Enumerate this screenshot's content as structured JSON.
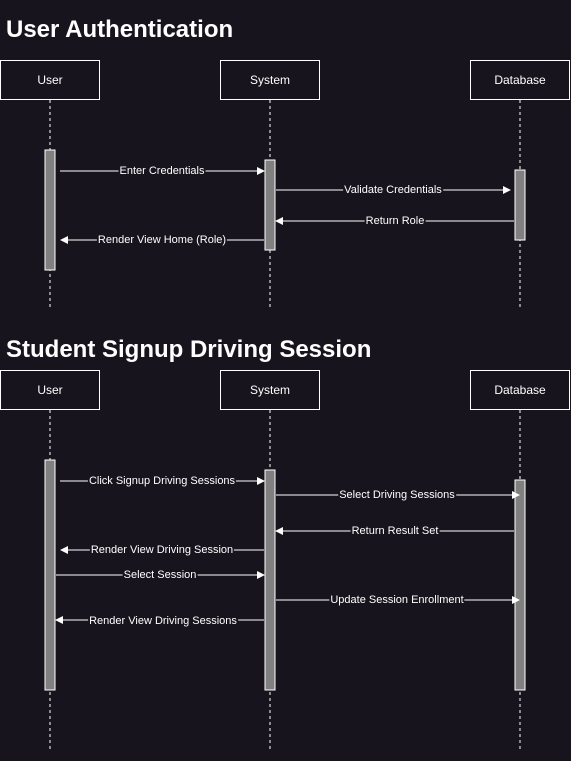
{
  "diagrams": [
    {
      "title": "User Authentication",
      "actors": [
        "User",
        "System",
        "Database"
      ],
      "messages": [
        {
          "label": "Enter Credentials",
          "from": "User",
          "to": "System"
        },
        {
          "label": "Validate Credentials",
          "from": "System",
          "to": "Database"
        },
        {
          "label": "Return Role",
          "from": "Database",
          "to": "System"
        },
        {
          "label": "Render View Home (Role)",
          "from": "System",
          "to": "User"
        }
      ]
    },
    {
      "title": "Student Signup Driving Session",
      "actors": [
        "User",
        "System",
        "Database"
      ],
      "messages": [
        {
          "label": "Click Signup Driving Sessions",
          "from": "User",
          "to": "System"
        },
        {
          "label": "Select Driving Sessions",
          "from": "System",
          "to": "Database"
        },
        {
          "label": "Return Result Set",
          "from": "Database",
          "to": "System"
        },
        {
          "label": "Render View Driving Session",
          "from": "System",
          "to": "User"
        },
        {
          "label": "Select Session",
          "from": "User",
          "to": "System"
        },
        {
          "label": "Update Session Enrollment",
          "from": "System",
          "to": "Database"
        },
        {
          "label": "Render View Driving Sessions",
          "from": "System",
          "to": "User"
        }
      ]
    }
  ],
  "colors": {
    "background": "#18141d",
    "stroke": "#ffffff",
    "activation_fill": "#808080"
  }
}
